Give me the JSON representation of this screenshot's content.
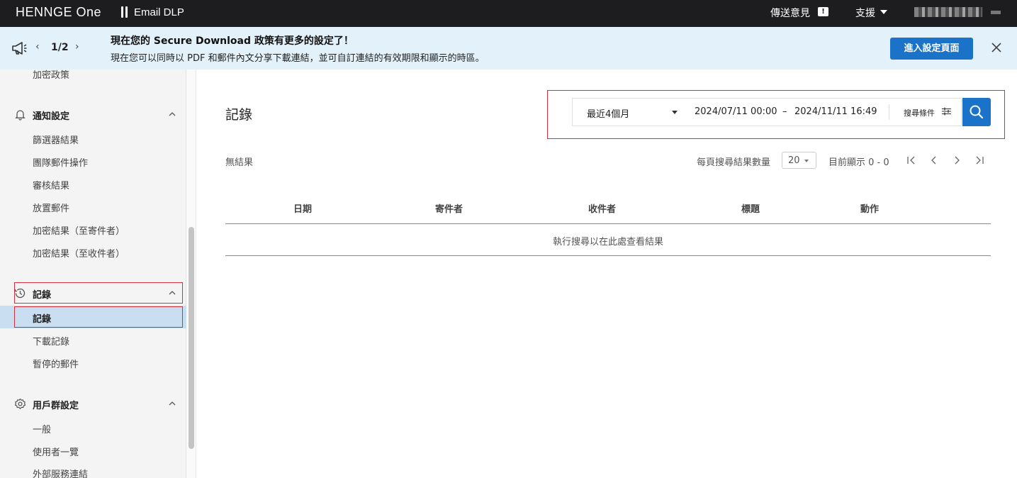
{
  "header": {
    "brand": "HENNGE One",
    "product": "Email DLP",
    "feedback_label": "傳送意見",
    "support_label": "支援"
  },
  "announcement": {
    "page_indicator": "1/2",
    "title": "現在您的 Secure Download 政策有更多的設定了！",
    "text": "現在您可以同時以 PDF 和郵件內文分享下載連結，並可自訂連結的有效期限和顯示的時區。",
    "button_label": "進入設定頁面"
  },
  "sidebar": {
    "top_item": "加密政策",
    "sections": [
      {
        "title": "通知設定",
        "items": [
          "篩選器結果",
          "團隊郵件操作",
          "審核結果",
          "放置郵件",
          "加密結果（至寄件者）",
          "加密結果（至收件者）"
        ]
      },
      {
        "title": "記錄",
        "items": [
          "記錄",
          "下載記錄",
          "暫停的郵件"
        ]
      },
      {
        "title": "用戶群設定",
        "items": [
          "一般",
          "使用者一覽",
          "外部服務連結"
        ]
      }
    ]
  },
  "main": {
    "title": "記錄",
    "search": {
      "period": "最近4個月",
      "date_from": "2024/07/11  00:00",
      "date_separator": "–",
      "date_to": "2024/11/11  16:49",
      "conditions_label": "搜尋條件"
    },
    "result_status": "無結果",
    "per_page_label": "每頁搜尋結果數量",
    "per_page_value": "20",
    "showing": "目前顯示 0 - 0",
    "table": {
      "columns": [
        "日期",
        "寄件者",
        "收件者",
        "標題",
        "動作"
      ],
      "empty_message": "執行搜尋以在此處查看結果"
    }
  },
  "colors": {
    "topbar": "#1d1d1f",
    "announcement_bg": "#e3f1fb",
    "primary": "#1a73c9",
    "highlight_border": "#d32f3c",
    "active_item_bg": "#c9def0"
  }
}
